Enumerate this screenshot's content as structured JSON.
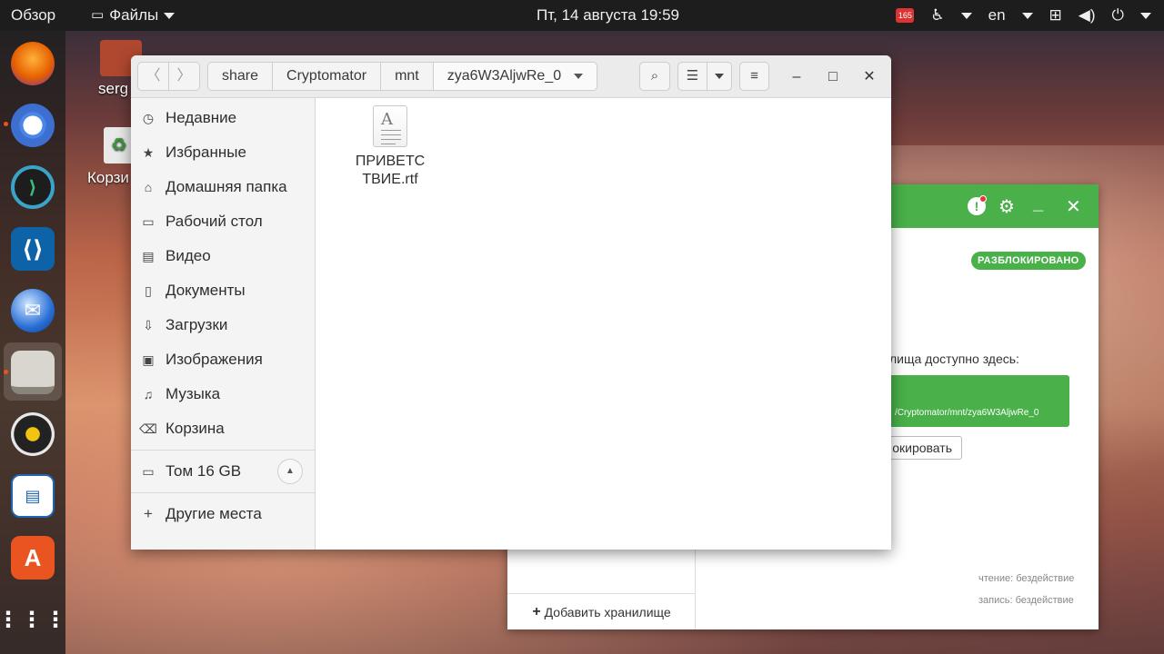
{
  "topbar": {
    "overview": "Обзор",
    "app_menu": "Файлы",
    "clock": "Пт, 14 августа  19:59",
    "notification_badge": "165",
    "lang": "en"
  },
  "desktop": {
    "home_label": "serg",
    "trash_label": "Корзи"
  },
  "files": {
    "breadcrumbs": [
      "share",
      "Cryptomator",
      "mnt",
      "zya6W3AljwRe_0"
    ],
    "sidebar": {
      "recent": "Недавние",
      "starred": "Избранные",
      "home": "Домашняя папка",
      "desktop": "Рабочий стол",
      "videos": "Видео",
      "documents": "Документы",
      "downloads": "Загрузки",
      "pictures": "Изображения",
      "music": "Музыка",
      "trash": "Корзина",
      "volume": "Том 16 GB",
      "other": "Другие места"
    },
    "items": [
      {
        "name": "ПРИВЕТСТВИЕ.rtf",
        "line1": "ПРИВЕТС",
        "line2": "ТВИЕ.rtf"
      }
    ]
  },
  "cryptomator": {
    "status_badge": "РАЗБЛОКИРОВАНО",
    "access_text": "лища доступно здесь:",
    "path": "/Cryptomator/mnt/zya6W3AljwRe_0",
    "lock_button": "окировать",
    "read_stat": "чтение:   бездействие",
    "write_stat": "запись:   бездействие",
    "add_vault": "Добавить хранилище"
  },
  "colors": {
    "accent_green": "#49b04a",
    "ubuntu_orange": "#e95420"
  }
}
